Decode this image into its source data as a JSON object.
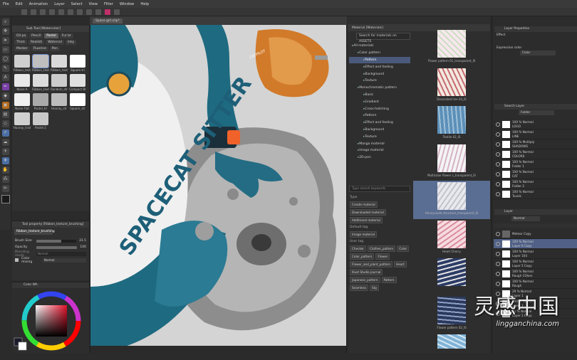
{
  "menu": [
    "File",
    "Edit",
    "Animation",
    "Layer",
    "Select",
    "View",
    "Filter",
    "Window",
    "Help"
  ],
  "canvas_tab": "Space girl.clip*",
  "subtool": {
    "tabs": [
      "Oil pa",
      "Pencil",
      "Pastel",
      "Fur br",
      "Thick",
      "Realisti",
      "Watercol",
      "Inky",
      "Marker",
      "Fluorine",
      "Pen"
    ],
    "brushes": [
      {
        "name": "Ribbon_text",
        "color": "#cfcfcf"
      },
      {
        "name": "Ribbon_text",
        "color": "#bfbfbf"
      },
      {
        "name": "Ribbon_text",
        "color": "#d9d9d9"
      },
      {
        "name": "Square-tri",
        "color": "#ffffff"
      },
      {
        "name": "Noise A",
        "color": "#e8e8e8"
      },
      {
        "name": "Ribbon_text",
        "color": "#dcdcdc"
      },
      {
        "name": "Random_str",
        "color": "#cccccc"
      },
      {
        "name": "Compact Br",
        "color": "#e0e0e0"
      },
      {
        "name": "Noise Flat",
        "color": "#f0f0f0"
      },
      {
        "name": "Pastel_tri",
        "color": "#aaaaaa"
      },
      {
        "name": "Hooray_str",
        "color": "#bdbdbd"
      },
      {
        "name": "Square_str",
        "color": "#ffffff"
      },
      {
        "name": "Hooray_trail",
        "color": "#d0d0d0"
      },
      {
        "name": "Pastel 2",
        "color": "#c8c8c8"
      }
    ]
  },
  "toolprop": {
    "title": "Tool property [Ribbon_texture_brushing]",
    "brush_name": "Ribbon_texture_brushing",
    "brush_size_label": "Brush Size",
    "brush_size": "31.5",
    "opacity_label": "Opacity",
    "opacity": "100",
    "blend_label": "Blending mode",
    "blend": "Normal",
    "color_mix_label": "Color mixing",
    "color_mix": "Normal"
  },
  "color_title": "Color Wh",
  "materials": {
    "header": "Material [Materials]",
    "search": "Search for materials on ASSETS",
    "tree": [
      {
        "label": "All materials",
        "indent": 0,
        "sel": false
      },
      {
        "label": "Color pattern",
        "indent": 1,
        "sel": false
      },
      {
        "label": "Pattern",
        "indent": 2,
        "sel": true
      },
      {
        "label": "Effect and feeling",
        "indent": 2,
        "sel": false
      },
      {
        "label": "Background",
        "indent": 2,
        "sel": false
      },
      {
        "label": "Texture",
        "indent": 2,
        "sel": false
      },
      {
        "label": "Monochromatic pattern",
        "indent": 1,
        "sel": false
      },
      {
        "label": "Basic",
        "indent": 2,
        "sel": false
      },
      {
        "label": "Gradient",
        "indent": 2,
        "sel": false
      },
      {
        "label": "Cross-hatching",
        "indent": 2,
        "sel": false
      },
      {
        "label": "Pattern",
        "indent": 2,
        "sel": false
      },
      {
        "label": "Effect and feeling",
        "indent": 2,
        "sel": false
      },
      {
        "label": "Background",
        "indent": 2,
        "sel": false
      },
      {
        "label": "Texture",
        "indent": 2,
        "sel": false
      },
      {
        "label": "Manga material",
        "indent": 1,
        "sel": false
      },
      {
        "label": "Image material",
        "indent": 1,
        "sel": false
      },
      {
        "label": "2D-pen",
        "indent": 1,
        "sel": false
      }
    ],
    "tag_search": "Type search keywords",
    "tag_groups": [
      {
        "title": "Type",
        "tags": [
          "Create material",
          "Downloaded material",
          "Additional material"
        ]
      },
      {
        "title": "Default tag",
        "tags": [
          "Image material"
        ]
      },
      {
        "title": "User tag",
        "tags": [
          "Checker",
          "Clothes_pattern",
          "Color",
          "Color_pattern",
          "Flower",
          "Flower_and_plant_pattern",
          "Heart",
          "Illust Studio journal",
          "Japanese_pattern",
          "Pattern",
          "Seamless",
          "Sky"
        ]
      }
    ],
    "items": [
      {
        "label": "Flower pattern 01_transparent_IS",
        "c1": "#f6e8ec",
        "c2": "#c8dcc0",
        "sel": false
      },
      {
        "label": "Decorated line 04_IS",
        "c1": "#f3e9df",
        "c2": "#c66b72",
        "sel": false
      },
      {
        "label": "Textile 02_IS",
        "c1": "#5c8fb8",
        "c2": "#9ec0d8",
        "sel": false
      },
      {
        "label": "Multicolor flower c_transparent_IS",
        "c1": "#f4f4f4",
        "c2": "#d6b3c7",
        "sel": false
      },
      {
        "label": "Honeycomb structure_transparent_IS",
        "c1": "#e8e8ee",
        "c2": "#c3c3cc",
        "sel": true
      },
      {
        "label": "Heart Cherry",
        "c1": "#f6dbe0",
        "c2": "#d98c9c",
        "sel": false
      },
      {
        "label": "",
        "c1": "#2c3c66",
        "c2": "#e3e3e3",
        "sel": false
      },
      {
        "label": "Flower pattern 02_IS",
        "c1": "#2b395c",
        "c2": "#8ea0c4",
        "sel": false
      },
      {
        "label": "Arabesque pattern_IS",
        "c1": "#7fb3d6",
        "c2": "#d8e7f2",
        "sel": false
      }
    ]
  },
  "right": {
    "layer_props": "Layer Properties",
    "effect": "Effect",
    "expression_label": "Expression color",
    "expression": "Color",
    "search_layer": "Search Layer",
    "folder": "Folder",
    "layer_title": "Layer",
    "blend": "Normal",
    "layers_top": [
      {
        "pct": "100 %",
        "mode": "Normal",
        "name": "LOGO",
        "sel": false
      },
      {
        "pct": "100 %",
        "mode": "Normal",
        "name": "LINE",
        "sel": false
      },
      {
        "pct": "100 %",
        "mode": "Multiply",
        "name": "SHADOWS",
        "sel": false
      },
      {
        "pct": "100 %",
        "mode": "Normal",
        "name": "COLORS",
        "sel": false
      },
      {
        "pct": "100 %",
        "mode": "Normal",
        "name": "Folder 1",
        "sel": false
      },
      {
        "pct": "100 %",
        "mode": "Normal",
        "name": "CAT",
        "sel": false
      },
      {
        "pct": "100 %",
        "mode": "Normal",
        "name": "Folder 2",
        "sel": false
      },
      {
        "pct": "100 %",
        "mode": "Normal",
        "name": "Tuvalc",
        "sel": false
      }
    ],
    "layers_bottom": [
      {
        "pct": "",
        "mode": "",
        "name": "Meteor Copy",
        "sel": false
      },
      {
        "pct": "100 %",
        "mode": "Normal",
        "name": "Layer 6 Copy",
        "sel": true
      },
      {
        "pct": "100 %",
        "mode": "Normal",
        "name": "Layer 104",
        "sel": false
      },
      {
        "pct": "100 %",
        "mode": "Normal",
        "name": "Layer 5 Copy",
        "sel": false
      },
      {
        "pct": "100 %",
        "mode": "Normal",
        "name": "Rough COlors",
        "sel": false
      },
      {
        "pct": "100 %",
        "mode": "Normal",
        "name": "Rough",
        "sel": false
      },
      {
        "pct": "29 %",
        "mode": "Normal",
        "name": "Layer 1",
        "sel": false
      },
      {
        "pct": "100 %",
        "mode": "Normal",
        "name": "Layer 1",
        "sel": false
      },
      {
        "pct": "11 %",
        "mode": "Normal",
        "name": "Layer 1 Copy",
        "sel": false
      }
    ]
  },
  "watermark": {
    "text": "灵感中国",
    "url": "lingganchina.com"
  },
  "canvas_text": "SPACECAT SITTER",
  "badge_text": "CATPILOT"
}
